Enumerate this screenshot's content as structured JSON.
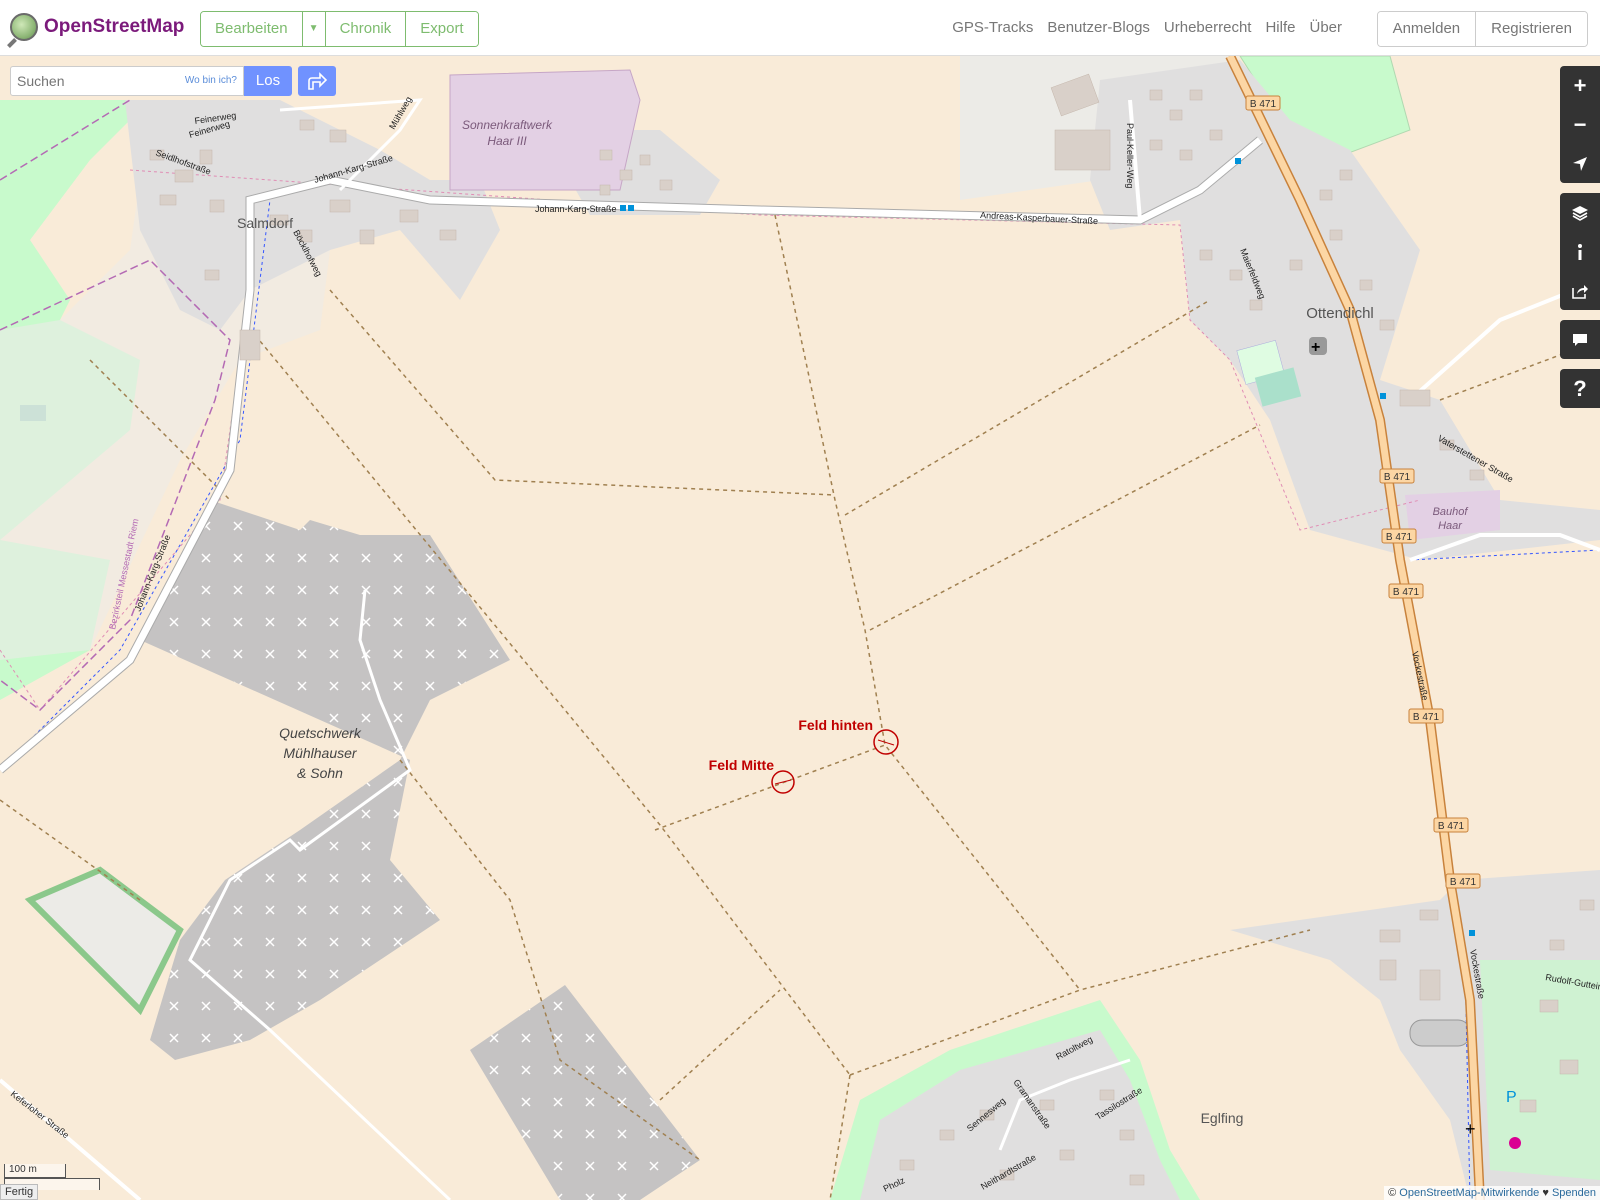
{
  "header": {
    "logo_text": "OpenStreetMap",
    "edit_button": "Bearbeiten",
    "history_button": "Chronik",
    "export_button": "Export",
    "links": [
      "GPS-Tracks",
      "Benutzer-Blogs",
      "Urheberrecht",
      "Hilfe",
      "Über"
    ],
    "login_button": "Anmelden",
    "register_button": "Registrieren"
  },
  "search": {
    "placeholder": "Suchen",
    "where_am_i": "Wo bin ich?",
    "go_button": "Los"
  },
  "controls": [
    "+",
    "−",
    "locate",
    "layers",
    "info",
    "share",
    "note",
    "?"
  ],
  "map_labels": {
    "villages": [
      "Salmdorf",
      "Ottendichl",
      "Eglfing"
    ],
    "areas": [
      "Sonnenkraftwerk",
      "Haar III",
      "Quetschwerk",
      "Mühlhauser",
      "& Sohn",
      "Bauhof",
      "Haar"
    ],
    "streets": [
      "Johann-Karg-Straße",
      "Johann-Karg-Straße",
      "Andreas-Kasperbauer-Straße",
      "Feinerweg",
      "Feinerweg",
      "Seidlhofstraße",
      "Mühlweg",
      "Böcklhofweg",
      "Paul-Keller-Weg",
      "Maierfeldweg",
      "Vaterstettener Straße",
      "Vockestraße",
      "Vockestraße",
      "Johann-Karg-Straße",
      "Bezirksteil Messestadt Riem",
      "Keferloher Straße",
      "Rudolf-Guttein",
      "Ratoltweg",
      "Gramanstraße",
      "Tassilostraße",
      "Sennesweg",
      "Neithardtstraße",
      "Pholz"
    ],
    "road_ref": "B 471",
    "markers": [
      "Feld hinten",
      "Feld Mitte"
    ]
  },
  "scale": {
    "metric": "100 m",
    "imperial": ""
  },
  "status": "Fertig",
  "attribution": {
    "copyright": "©",
    "contributors": "OpenStreetMap-Mitwirkende",
    "heart": "♥",
    "donate": "Spenden"
  },
  "colors": {
    "farmland": "#f9ebd8",
    "residential": "#e0dfdf",
    "quarry": "#c5c3c3",
    "forest": "#c8facc",
    "solar": "#e3d0e4",
    "primary_road": "#fcd6a4",
    "osm_green": "#7ebc6f",
    "search_blue": "#7092ff",
    "marker_red": "#c00000"
  }
}
